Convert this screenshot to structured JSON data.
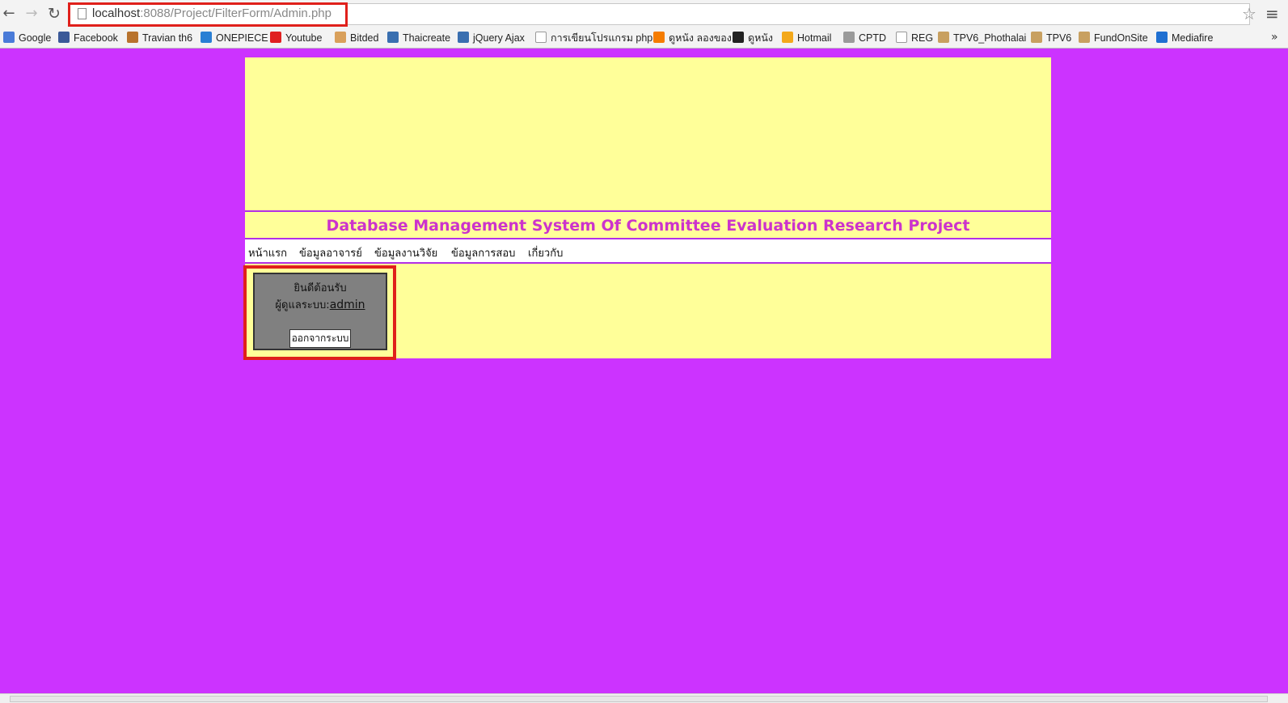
{
  "browser": {
    "url_host": "localhost",
    "url_rest": ":8088/Project/FilterForm/Admin.php",
    "nav": {
      "back": "←",
      "forward": "→",
      "reload": "↻"
    },
    "star": "☆",
    "menu": "≡",
    "bookmarks_more": "»",
    "bookmarks": [
      {
        "label": "Google",
        "color": "#4a7bd8"
      },
      {
        "label": "Facebook",
        "color": "#3b5998"
      },
      {
        "label": "Travian th6",
        "color": "#b8732e"
      },
      {
        "label": "ONEPIECE",
        "color": "#2a7fd4"
      },
      {
        "label": "Youtube",
        "color": "#e02020"
      },
      {
        "label": "Bitded",
        "color": "#d9a05b"
      },
      {
        "label": "Thaicreate",
        "color": "#3a6fb0"
      },
      {
        "label": "jQuery Ajax",
        "color": "#3a6fb0"
      },
      {
        "label": "การเขียนโปรแกรม php",
        "color": "#ffffff"
      },
      {
        "label": "ดูหนัง ลองของ",
        "color": "#f57c00"
      },
      {
        "label": "ดูหนัง",
        "color": "#222222"
      },
      {
        "label": "Hotmail",
        "color": "#f3a81b"
      },
      {
        "label": "CPTD",
        "color": "#9a9a9a"
      },
      {
        "label": "REG",
        "color": "#ffffff"
      },
      {
        "label": "TPV6_Phothalai",
        "color": "#c8a060"
      },
      {
        "label": "TPV6",
        "color": "#c8a060"
      },
      {
        "label": "FundOnSite",
        "color": "#c8a060"
      },
      {
        "label": "Mediafire",
        "color": "#1f6fd1"
      }
    ]
  },
  "site": {
    "title": "Database Management System Of Committee Evaluation Research Project",
    "menu": [
      "หน้าแรก",
      "ข้อมูลอาจารย์",
      "ข้อมูลงานวิจัย",
      "ข้อมูลการสอบ",
      "เกี่ยวกับ"
    ],
    "login": {
      "welcome": "ยินดีต้อนรับ",
      "admin_prefix": "ผู้ดูแลระบบ:",
      "admin_name": "admin",
      "logout": "ออกจากระบบ"
    }
  },
  "colors": {
    "page_bg": "#cc33ff",
    "panel_bg": "#ffff99",
    "title": "#cc33cc",
    "highlight": "#e0201b",
    "login_bg": "#808080"
  }
}
